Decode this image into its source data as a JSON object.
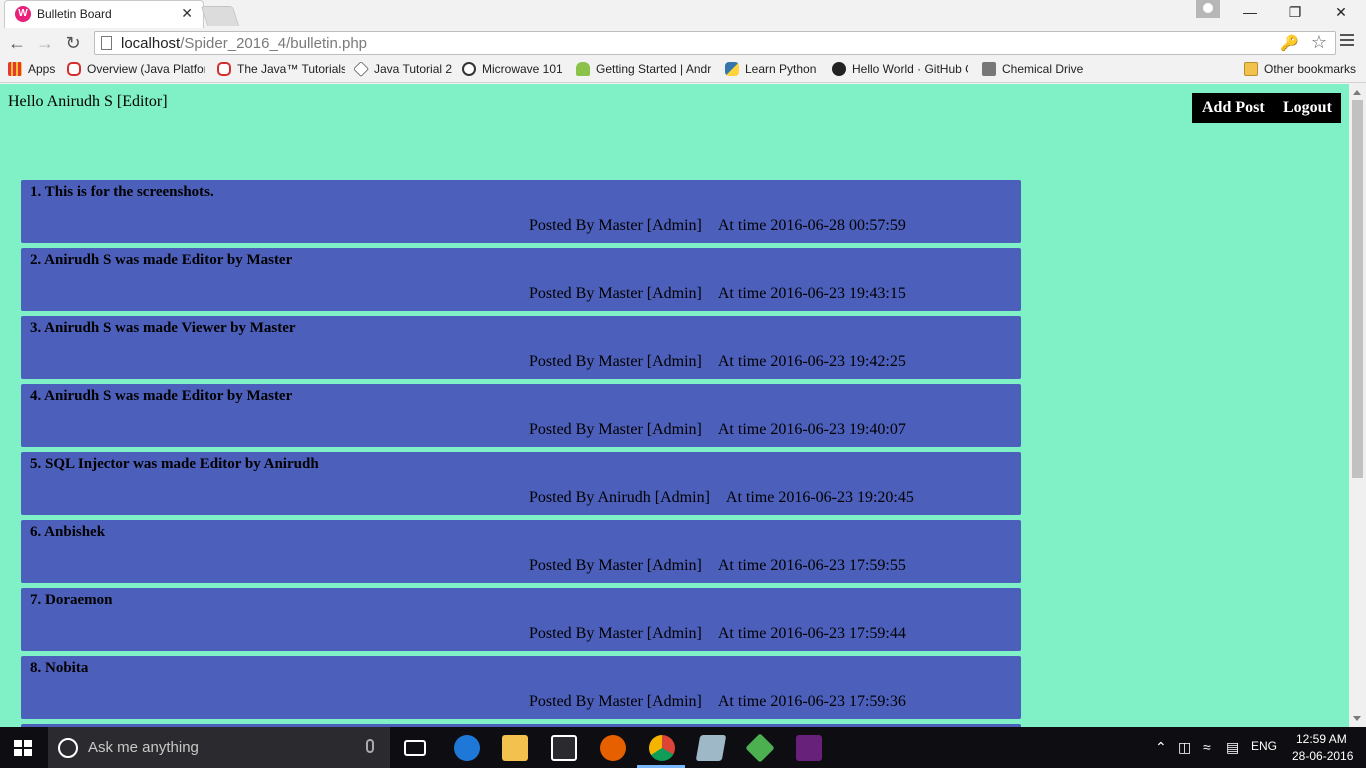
{
  "browser": {
    "tab_title": "Bulletin Board",
    "tab_favicon_glyph": "W",
    "tab_close_glyph": "✕",
    "url_host": "localhost",
    "url_path": "/Spider_2016_4/bulletin.php",
    "bookmarks": [
      {
        "label": "Apps",
        "icon": "apps-grid-icon"
      },
      {
        "label": "Overview (Java Platfor",
        "icon": "oracle-icon"
      },
      {
        "label": "The Java™ Tutorials",
        "icon": "oracle-icon"
      },
      {
        "label": "Java Tutorial 2",
        "icon": "diamond-icon"
      },
      {
        "label": "Microwave 101",
        "icon": "globe-icon"
      },
      {
        "label": "Getting Started | Andr",
        "icon": "android-icon"
      },
      {
        "label": "Learn Python",
        "icon": "python-icon"
      },
      {
        "label": "Hello World · GitHub G",
        "icon": "github-icon"
      },
      {
        "label": "Chemical Drive",
        "icon": "chemical-drive-icon"
      }
    ],
    "other_bookmarks": "Other bookmarks"
  },
  "page": {
    "greeting": "Hello Anirudh S [Editor]",
    "nav": {
      "add_post": "Add Post",
      "logout": "Logout"
    },
    "posts": [
      {
        "title": "1. This is for the screenshots.",
        "posted_by": "Posted By Master [Admin]",
        "time": "At time 2016-06-28 00:57:59"
      },
      {
        "title": "2. Anirudh S was made Editor by Master",
        "posted_by": "Posted By Master [Admin]",
        "time": "At time 2016-06-23 19:43:15"
      },
      {
        "title": "3. Anirudh S was made Viewer by Master",
        "posted_by": "Posted By Master [Admin]",
        "time": "At time 2016-06-23 19:42:25"
      },
      {
        "title": "4. Anirudh S was made Editor by Master",
        "posted_by": "Posted By Master [Admin]",
        "time": "At time 2016-06-23 19:40:07"
      },
      {
        "title": "5. SQL Injector was made Editor by Anirudh",
        "posted_by": "Posted By Anirudh [Admin]",
        "time": "At time 2016-06-23 19:20:45"
      },
      {
        "title": "6. Anbishek",
        "posted_by": "Posted By Master [Admin]",
        "time": "At time 2016-06-23 17:59:55"
      },
      {
        "title": "7. Doraemon",
        "posted_by": "Posted By Master [Admin]",
        "time": "At time 2016-06-23 17:59:44"
      },
      {
        "title": "8. Nobita",
        "posted_by": "Posted By Master [Admin]",
        "time": "At time 2016-06-23 17:59:36"
      }
    ]
  },
  "taskbar": {
    "search_placeholder": "Ask me anything",
    "language": "ENG",
    "time": "12:59 AM",
    "date": "28-06-2016"
  },
  "colors": {
    "page_background": "#80f0c6",
    "post_background": "#4c5fba",
    "nav_background": "#000000"
  }
}
